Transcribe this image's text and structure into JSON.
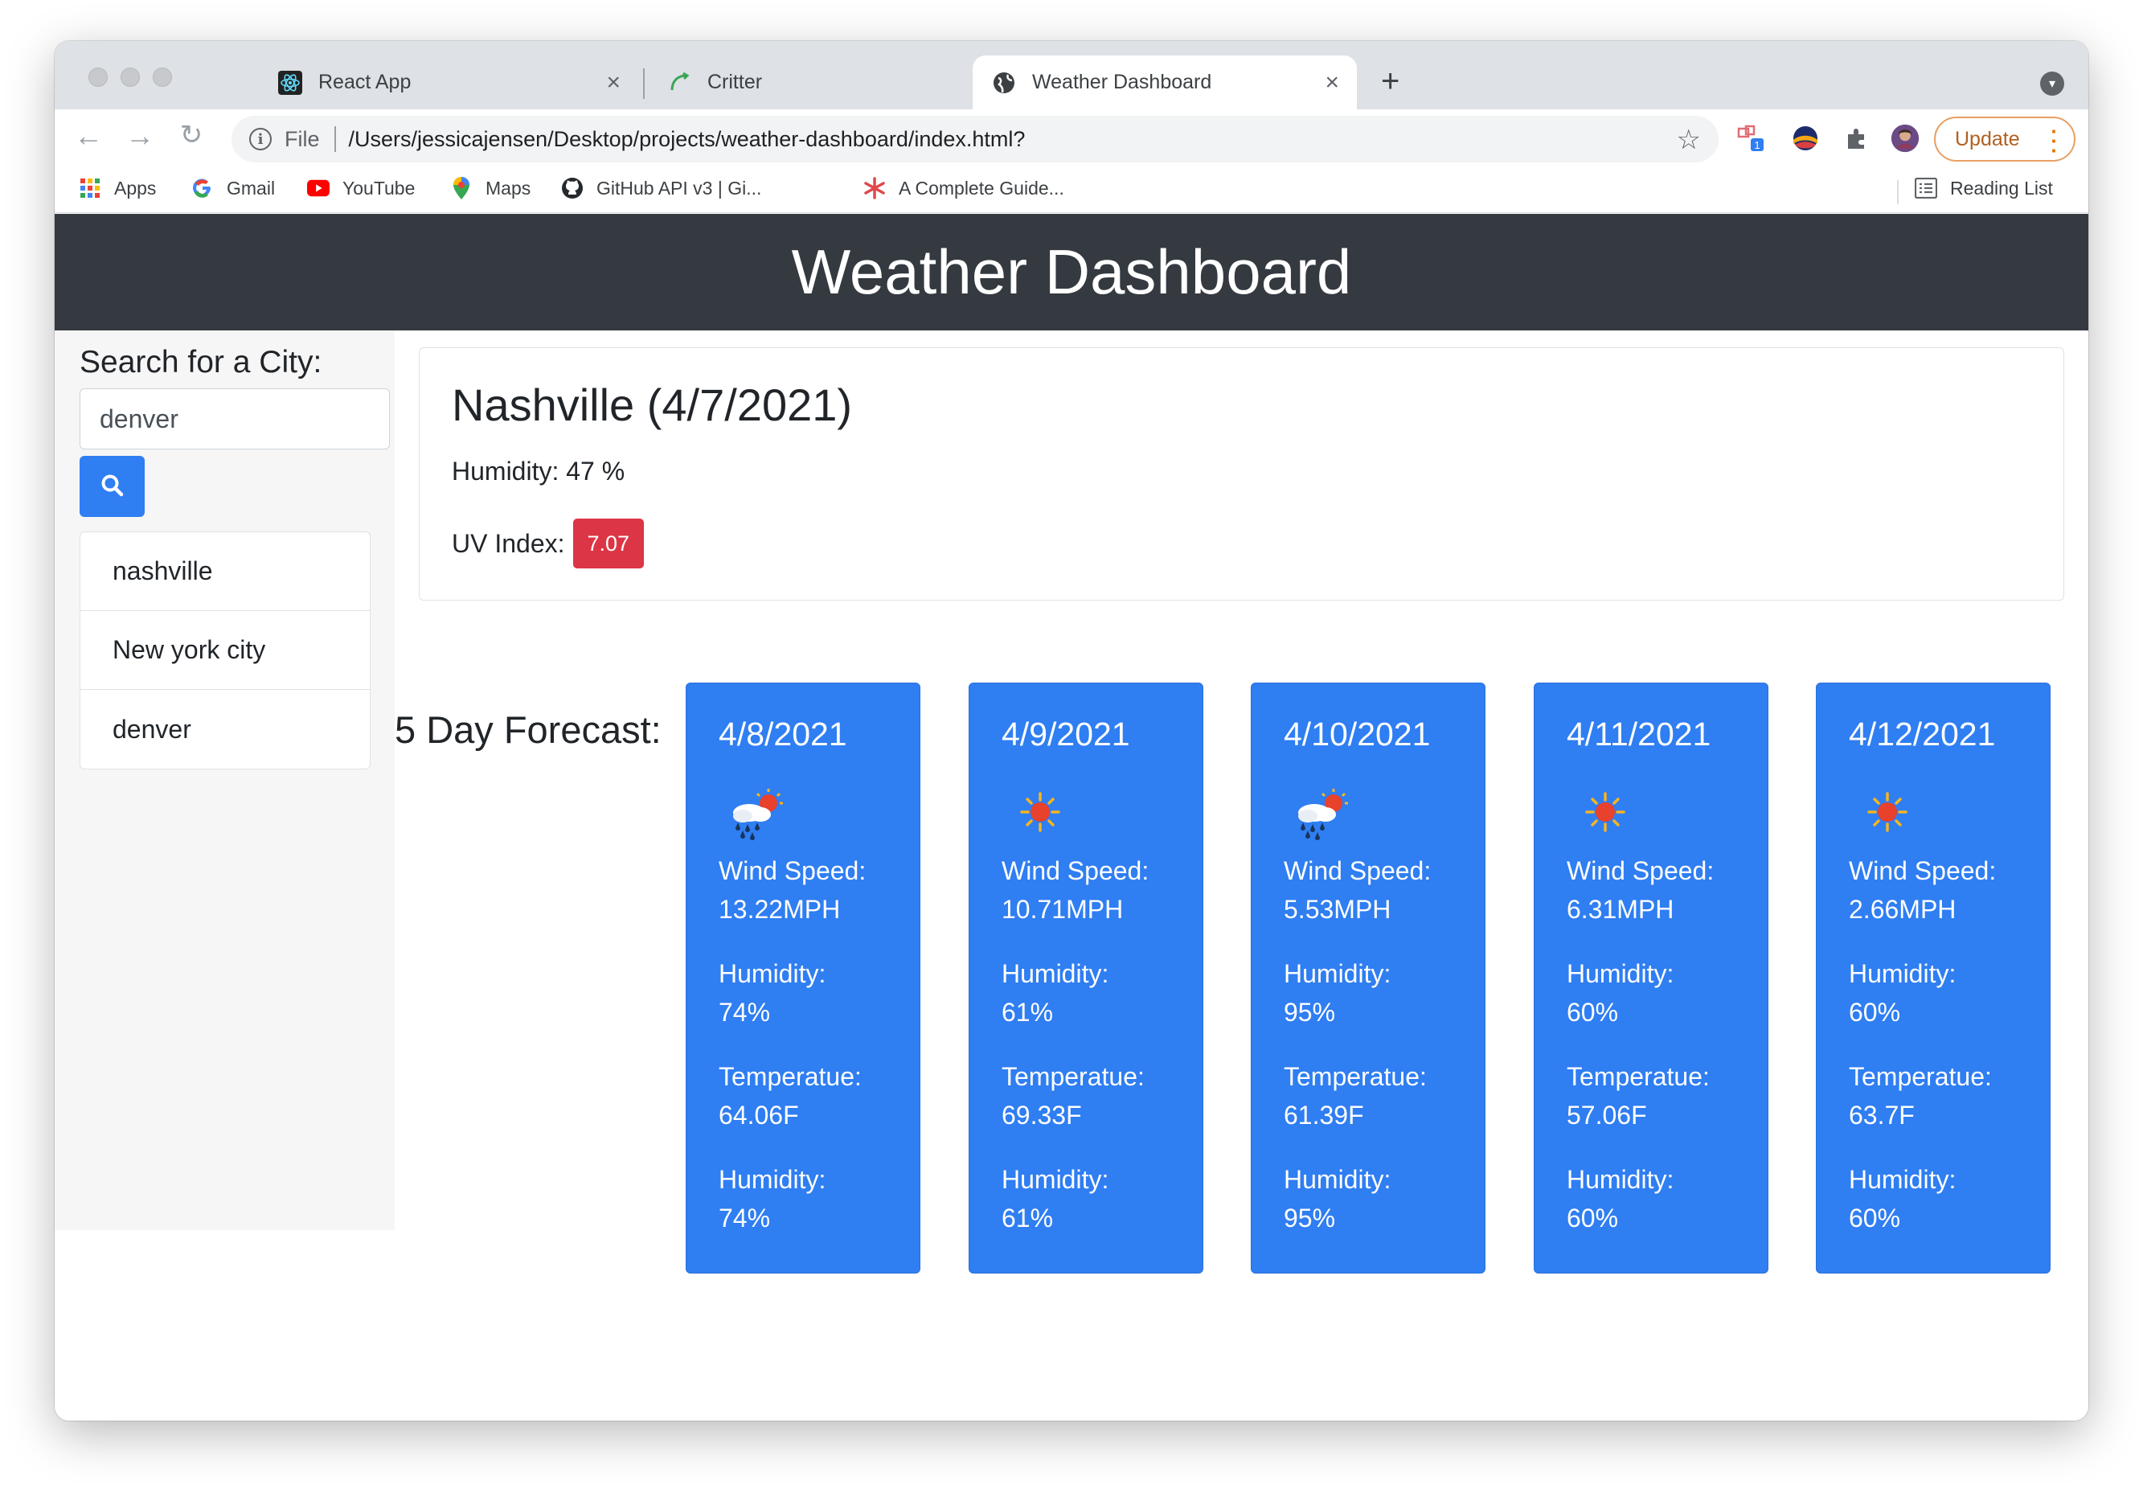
{
  "browser": {
    "tabs": [
      {
        "title": "React App",
        "active": false
      },
      {
        "title": "Critter",
        "active": false
      },
      {
        "title": "Weather Dashboard",
        "active": true
      }
    ],
    "address": {
      "scheme": "File",
      "url": "/Users/jessicajensen/Desktop/projects/weather-dashboard/index.html?"
    },
    "update_label": "Update",
    "extension_badge": "1",
    "bookmarks": [
      "Apps",
      "Gmail",
      "YouTube",
      "Maps",
      "GitHub API v3 | Gi...",
      "A Complete Guide..."
    ],
    "reading_list": "Reading List"
  },
  "header": {
    "title": "Weather Dashboard"
  },
  "sidebar": {
    "search_label": "Search for a City:",
    "search_value": "denver",
    "history": [
      "nashville",
      "New york city",
      "denver"
    ]
  },
  "current": {
    "title": "Nashville (4/7/2021)",
    "humidity": "Humidity: 47 %",
    "uv_label": "UV Index:",
    "uv_value": "7.07"
  },
  "forecast": {
    "label": "5 Day Forecast:",
    "days": [
      {
        "date": "4/8/2021",
        "icon": "rain-sun-icon",
        "wind_label": "Wind Speed:",
        "wind": "13.22MPH",
        "humidity_label": "Humidity:",
        "humidity": "74%",
        "temp_label": "Temperatue:",
        "temp": "64.06F",
        "humidity2_label": "Humidity:",
        "humidity2": "74%"
      },
      {
        "date": "4/9/2021",
        "icon": "sun-icon",
        "wind_label": "Wind Speed:",
        "wind": "10.71MPH",
        "humidity_label": "Humidity:",
        "humidity": "61%",
        "temp_label": "Temperatue:",
        "temp": "69.33F",
        "humidity2_label": "Humidity:",
        "humidity2": "61%"
      },
      {
        "date": "4/10/2021",
        "icon": "rain-sun-icon",
        "wind_label": "Wind Speed:",
        "wind": "5.53MPH",
        "humidity_label": "Humidity:",
        "humidity": "95%",
        "temp_label": "Temperatue:",
        "temp": "61.39F",
        "humidity2_label": "Humidity:",
        "humidity2": "95%"
      },
      {
        "date": "4/11/2021",
        "icon": "sun-icon",
        "wind_label": "Wind Speed:",
        "wind": "6.31MPH",
        "humidity_label": "Humidity:",
        "humidity": "60%",
        "temp_label": "Temperatue:",
        "temp": "57.06F",
        "humidity2_label": "Humidity:",
        "humidity2": "60%"
      },
      {
        "date": "4/12/2021",
        "icon": "sun-icon",
        "wind_label": "Wind Speed:",
        "wind": "2.66MPH",
        "humidity_label": "Humidity:",
        "humidity": "60%",
        "temp_label": "Temperatue:",
        "temp": "63.7F",
        "humidity2_label": "Humidity:",
        "humidity2": "60%"
      }
    ]
  },
  "colors": {
    "header_bg": "#343a40",
    "card_blue": "#2f7ef2",
    "uv_red": "#dc3545",
    "update_orange": "#e37400"
  }
}
